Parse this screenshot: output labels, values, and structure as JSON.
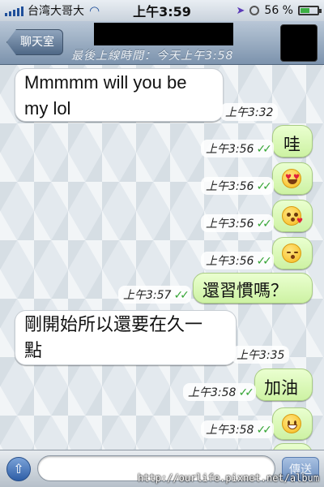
{
  "status_bar": {
    "carrier": "台湾大哥大",
    "time": "上午3:59",
    "battery": "56 %",
    "battery_level": 0.56
  },
  "nav": {
    "back_label": "聊天室",
    "subtitle": "最後上線時間：今天上午3:58"
  },
  "messages": [
    {
      "direction": "incoming",
      "text_lines": [
        "Mmmmm will you be",
        "my lol"
      ],
      "time": "上午3:32"
    },
    {
      "direction": "outgoing",
      "text": "哇",
      "time": "上午3:56"
    },
    {
      "direction": "outgoing",
      "emoji": "heart-eyes-emoji",
      "time": "上午3:56"
    },
    {
      "direction": "outgoing",
      "emoji": "kissing-heart-emoji",
      "time": "上午3:56"
    },
    {
      "direction": "outgoing",
      "emoji": "kissing-smiling-eyes-emoji",
      "time": "上午3:56"
    },
    {
      "direction": "outgoing",
      "text": "還習慣嗎？",
      "time": "上午3:57"
    },
    {
      "direction": "incoming",
      "text_lines": [
        "剛開始所以還要在久一",
        "點"
      ],
      "time": "上午3:35"
    },
    {
      "direction": "outgoing",
      "text": "加油",
      "time": "上午3:58"
    },
    {
      "direction": "outgoing",
      "emoji": "grinning-emoji",
      "time": "上午3:58"
    }
  ],
  "composer": {
    "placeholder": "",
    "send_label": "傳送"
  },
  "watermark": "http://ourlife.pixnet.net/album",
  "colors": {
    "outgoing_bubble": "#dcf8c6",
    "incoming_bubble": "#ffffff",
    "read_tick": "#35a535"
  }
}
